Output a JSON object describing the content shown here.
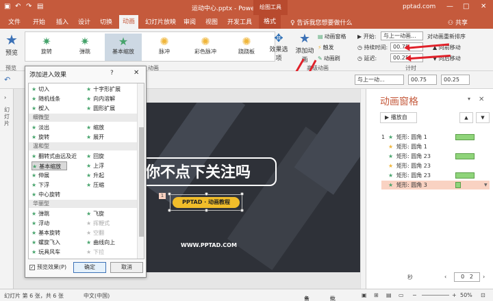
{
  "window": {
    "title": "运动中心.pptx - PowerPoint",
    "drawing_tools": "绘图工具",
    "site": "pptad.com",
    "min": "—",
    "restore": "□",
    "close": "✕"
  },
  "tabs": [
    "文件",
    "开始",
    "插入",
    "设计",
    "切换",
    "动画",
    "幻灯片放映",
    "审阅",
    "视图",
    "开发工具",
    "格式"
  ],
  "tell_me": "告诉我您想要做什么",
  "share": "共享",
  "ribbon": {
    "preview": "预览",
    "preview_group": "预览",
    "animations": [
      {
        "label": "旋转",
        "color": "#46a36b"
      },
      {
        "label": "弹跳",
        "color": "#46a36b"
      },
      {
        "label": "基本缩放",
        "color": "#46a36b",
        "selected": true
      },
      {
        "label": "脉冲",
        "color": "#f0b63a"
      },
      {
        "label": "彩色脉冲",
        "color": "#f0b63a"
      },
      {
        "label": "跷跷板",
        "color": "#f0b63a"
      }
    ],
    "animation_group": "动画",
    "effect_options": "效果选项",
    "add_animation": "添加动画",
    "anim_pane": "动画窗格",
    "trigger": "触发",
    "anim_painter": "动画刷",
    "advanced_group": "高级动画",
    "start_label": "开始:",
    "start_value": "与上一动画...",
    "duration_label": "持续时间:",
    "duration_value": "00.75",
    "delay_label": "延迟:",
    "delay_value": "00.25",
    "reorder": "对动画重新排序",
    "move_earlier": "向前移动",
    "move_later": "向后移动",
    "timing_group": "计时"
  },
  "toolbar2": {
    "start_value": "与上一动...",
    "duration_value": "00.75",
    "delay_value": "00.25"
  },
  "thumbnails_label": "幻灯片",
  "slide": {
    "big_text": "你不点下关注吗",
    "pill": "PPTAD · 动画教程",
    "tag": "1",
    "url": "WWW.PPTAD.COM"
  },
  "pane": {
    "title": "动画窗格",
    "close": "✕",
    "play": "播放自",
    "items": [
      {
        "num": "1",
        "name": "矩形: 圆角 1",
        "color": "#46a36b",
        "bar": true
      },
      {
        "num": "",
        "name": "矩形: 圆角 1",
        "color": "#f0b63a",
        "bar": false
      },
      {
        "num": "",
        "name": "矩形: 圆角 23",
        "color": "#46a36b",
        "bar": true
      },
      {
        "num": "",
        "name": "矩形: 圆角 23",
        "color": "#f0b63a",
        "bar": false
      },
      {
        "num": "",
        "name": "矩形: 圆角 23",
        "color": "#46a36b",
        "bar": true
      },
      {
        "num": "",
        "name": "矩形: 圆角 3",
        "color": "#46a36b",
        "bar": true,
        "selected": true
      }
    ],
    "seconds": "秒",
    "zoom_left": "0",
    "zoom_right": "2"
  },
  "dialog": {
    "title": "添加进入效果",
    "help": "?",
    "close": "✕",
    "rows": [
      {
        "type": "pair",
        "left": "切入",
        "right": "十字形扩展"
      },
      {
        "type": "pair",
        "left": "随机线条",
        "right": "向内溶解"
      },
      {
        "type": "pair",
        "left": "楔入",
        "right": "圆形扩展"
      },
      {
        "type": "cat",
        "label": "细微型"
      },
      {
        "type": "pair",
        "left": "淡出",
        "right": "缩放"
      },
      {
        "type": "pair",
        "left": "旋转",
        "right": "展开"
      },
      {
        "type": "cat",
        "label": "温和型"
      },
      {
        "type": "pair",
        "left": "翻转式由远及近",
        "right": "回旋"
      },
      {
        "type": "pair",
        "left": "基本缩放",
        "right": "上浮",
        "left_selected": true
      },
      {
        "type": "pair",
        "left": "伸展",
        "right": "升起"
      },
      {
        "type": "pair",
        "left": "下浮",
        "right": "压缩"
      },
      {
        "type": "single",
        "left": "中心旋转"
      },
      {
        "type": "cat",
        "label": "华丽型"
      },
      {
        "type": "pair",
        "left": "弹跳",
        "right": "飞旋"
      },
      {
        "type": "pair",
        "left": "浮动",
        "right": "挥鞭式",
        "right_disabled": true
      },
      {
        "type": "pair",
        "left": "基本旋转",
        "right": "空翻",
        "right_disabled": true
      },
      {
        "type": "pair",
        "left": "螺旋飞入",
        "right": "曲线向上"
      },
      {
        "type": "pair",
        "left": "玩具风车",
        "right": "下拉",
        "right_disabled": true
      }
    ],
    "preview_checkbox": "预览效果(P)",
    "ok": "确定",
    "cancel": "取消"
  },
  "status": {
    "slide_info": "幻灯片 第 6 张，共 6 张",
    "language": "中文(中国)",
    "notes": "备注",
    "comments": "批注",
    "zoom": "50%"
  },
  "colors": {
    "accent": "#c55a3c",
    "arrow": "#e0212a"
  }
}
